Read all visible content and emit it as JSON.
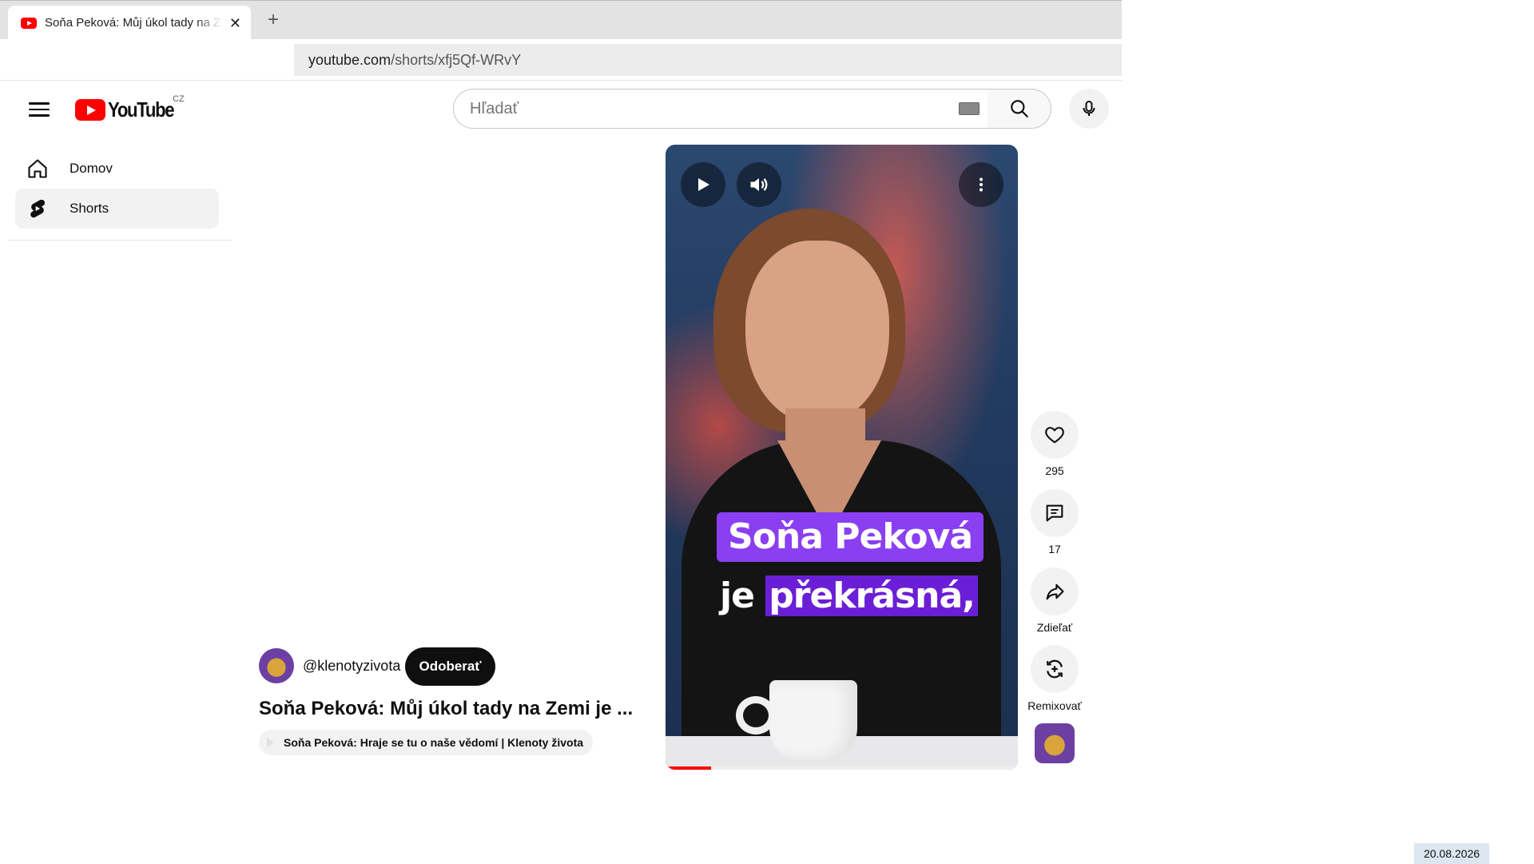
{
  "browser": {
    "tab_title": "Soňa Peková: Můj úkol tady na Zemi je překrásná",
    "close_glyph": "✕",
    "new_tab_glyph": "+",
    "url_host": "youtube.com",
    "url_path": "/shorts/xfj5Qf-WRvY"
  },
  "header": {
    "logo_text": "YouTube",
    "country_code": "CZ",
    "search_placeholder": "Hľadať"
  },
  "sidebar": {
    "items": [
      {
        "label": "Domov",
        "icon": "home-icon",
        "active": false
      },
      {
        "label": "Shorts",
        "icon": "shorts-icon",
        "active": true
      }
    ]
  },
  "short": {
    "caption_line1": "Soňa Peková",
    "caption_line2_plain": "je",
    "caption_line2_highlight": "překrásná,",
    "progress": 0.13,
    "channel_handle": "@klenotyzivota",
    "subscribe_label": "Odoberať",
    "title": "Soňa Peková: Můj úkol tady na Zemi je ...",
    "related_video": "Soňa Peková: Hraje se tu o naše vědomí | Klenoty života"
  },
  "actions": {
    "likes": "295",
    "comments": "17",
    "share_label": "Zdieľať",
    "remix_label": "Remixovať"
  },
  "taskbar": {
    "date": "20.08.2026"
  },
  "colors": {
    "accent": "#ff0000",
    "caption_bg": "#8a3ff2",
    "caption_highlight": "#6a1fd6"
  }
}
